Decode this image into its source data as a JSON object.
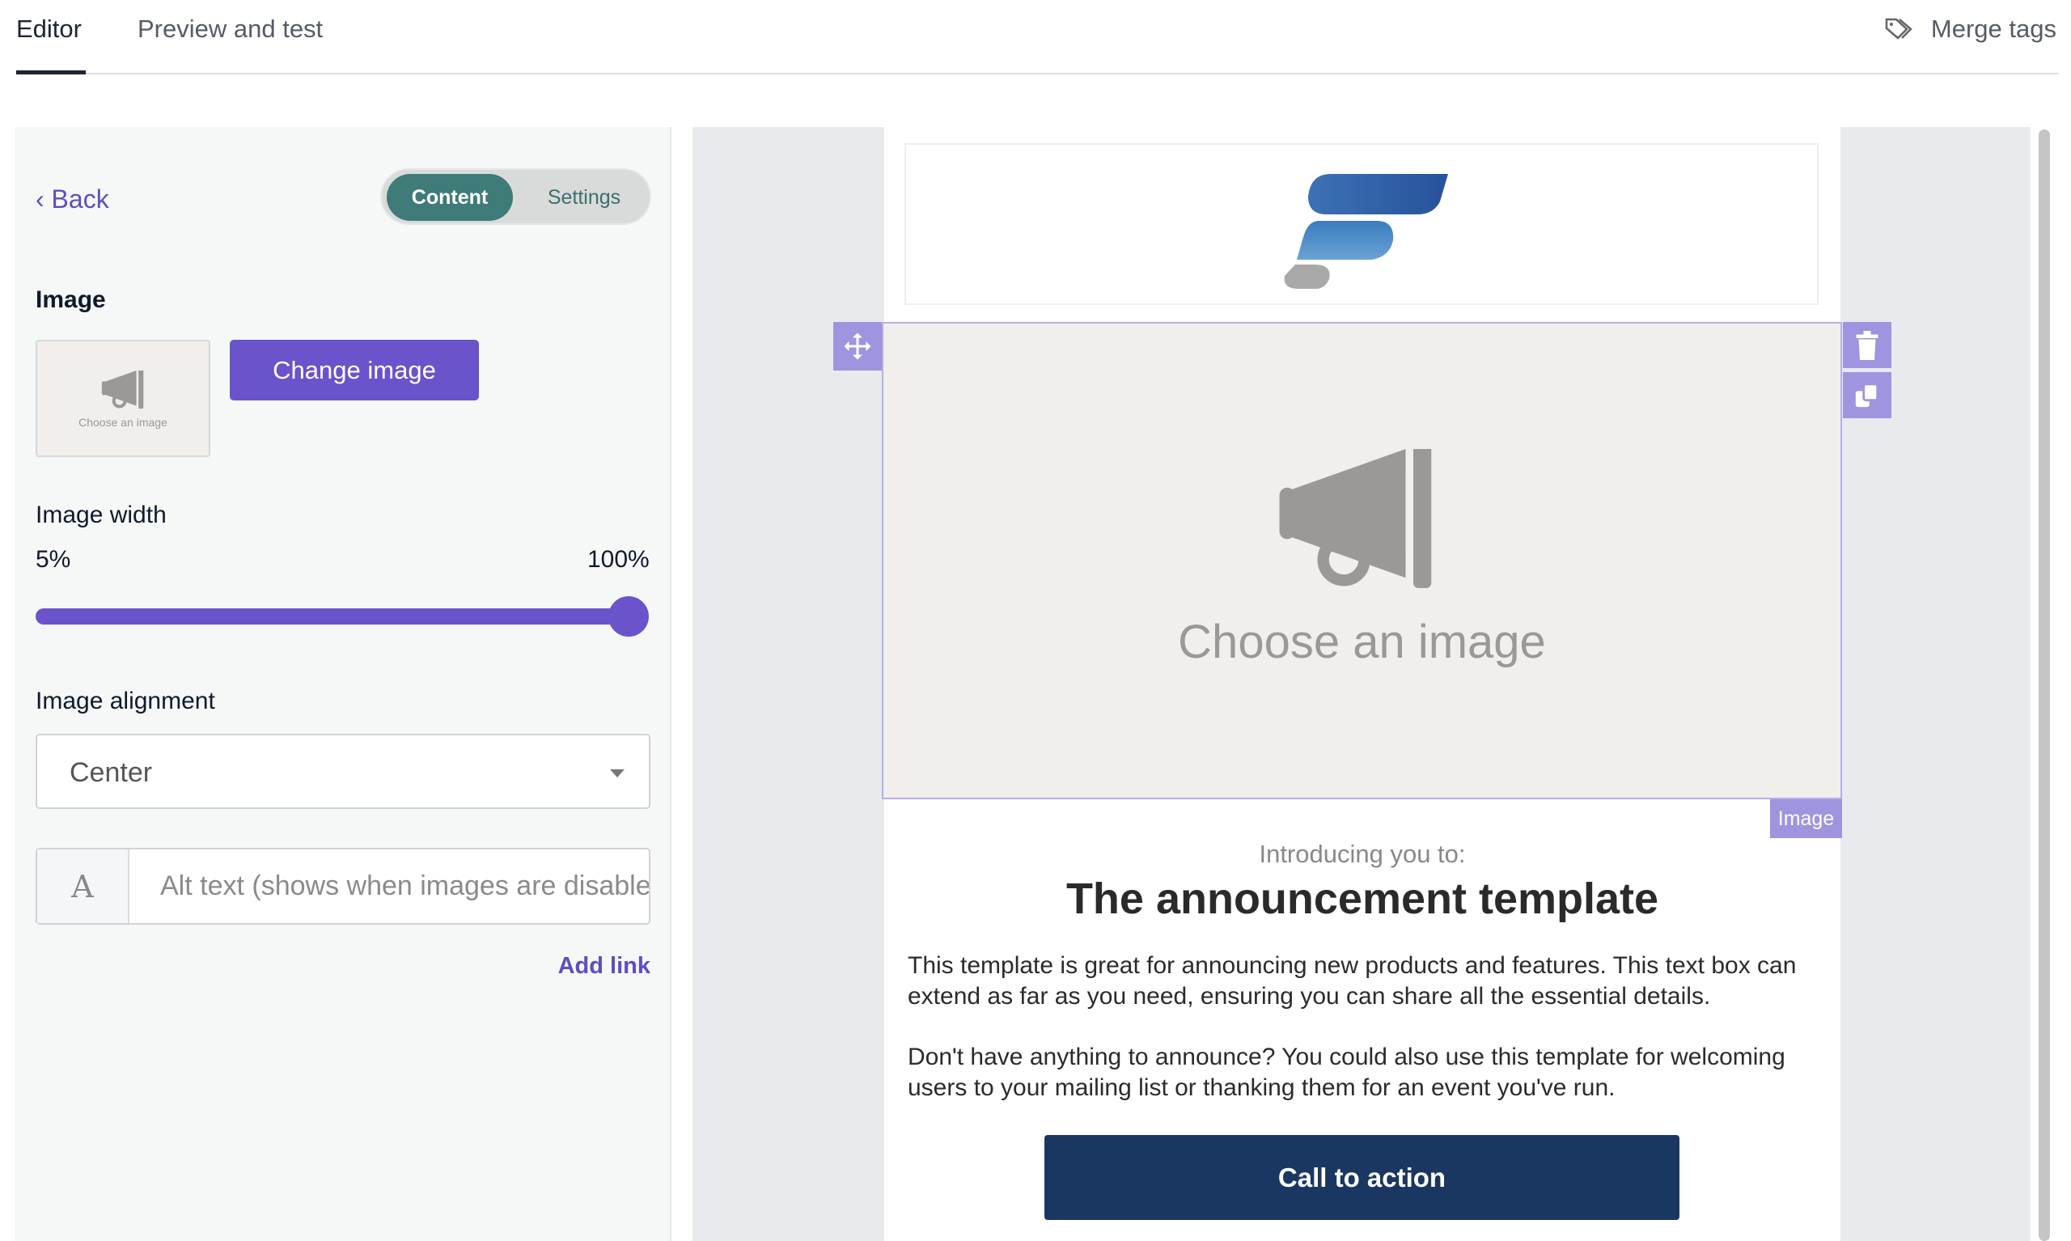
{
  "tabs": [
    {
      "label": "Editor",
      "active": true
    },
    {
      "label": "Preview and test",
      "active": false
    }
  ],
  "merge_tags": {
    "label": "Merge tags",
    "icon": "tag-icon"
  },
  "panel": {
    "back_label": "Back",
    "toggle": {
      "content": "Content",
      "settings": "Settings",
      "selected": "Content"
    },
    "image_label": "Image",
    "thumbnail_text": "Choose an image",
    "change_image": "Change image",
    "image_width_label": "Image width",
    "width_min": "5%",
    "width_max": "100%",
    "width_value_percent": 100,
    "alignment_label": "Image alignment",
    "alignment_value": "Center",
    "alt_placeholder": "Alt text (shows when images are disabled)",
    "alt_icon_letter": "A",
    "add_link": "Add link"
  },
  "email": {
    "image_placeholder": "Choose an image",
    "block_tag": "Image",
    "intro": "Introducing you to:",
    "title": "The announcement template",
    "para1": "This template is great for announcing new products and features. This text box can extend as far as you need, ensuring you can share all the essential details.",
    "para2": "Don't have anything to announce? You could also use this template for welcoming users to your mailing list or thanking them for an event you've run.",
    "cta": "Call to action"
  },
  "colors": {
    "accent": "#6a53cb",
    "toggle_active": "#3f7c79",
    "cta": "#1a3761",
    "handle": "#9f94e0"
  }
}
